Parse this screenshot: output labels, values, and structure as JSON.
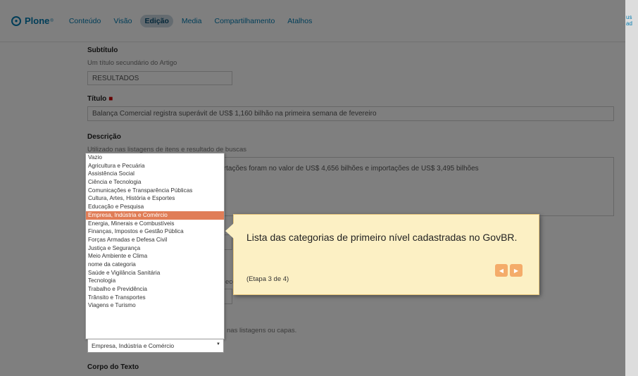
{
  "toolbar": {
    "logo": "Plone",
    "nav": [
      "Conteúdo",
      "Visão",
      "Edição",
      "Media",
      "Compartilhamento",
      "Atalhos"
    ],
    "active": "Edição",
    "user": "us ad"
  },
  "form": {
    "subtitle_label": "Subtítulo",
    "subtitle_help": "Um título secundário do Artigo",
    "subtitle_value": "RESULTADOS",
    "title_label": "Título",
    "title_value": "Balança Comercial registra superávit de US$ 1,160 bilhão na primeira semana de fevereiro",
    "description_label": "Descrição",
    "description_help": "Utilizado nas listagens de itens e resultado de buscas",
    "description_value": "Exportações foram no valor de US$ 4,656 bilhões e importações de US$ 3,495 bilhões",
    "partial_text_1": "eco",
    "partial_help_2": "nas listagens ou capas.",
    "body_label": "Corpo do Texto"
  },
  "dropdown": {
    "options": [
      "Vazio",
      "Agricultura e Pecuária",
      "Assistência Social",
      "Ciência e Tecnologia",
      "Comunicações e Transparência Públicas",
      "Cultura, Artes, História e Esportes",
      "Educação e Pesquisa",
      "Empresa, Indústria e Comércio",
      "Energia, Minerais e Combustíveis",
      "Finanças, Impostos e Gestão Pública",
      "Forças Armadas e Defesa Civil",
      "Justiça e Segurança",
      "Meio Ambiente e Clima",
      "nome da categoria",
      "Saúde e Vigilância Sanitária",
      "Tecnologia",
      "Trabalho e Previdência",
      "Trânsito e Transportes",
      "Viagens e Turismo"
    ],
    "selected_index": 7,
    "selected_value": "Empresa, Indústria e Comércio"
  },
  "tour": {
    "text": "Lista das categorias de primeiro nível cadastradas no GovBR.",
    "step": "(Etapa 3 de 4)"
  }
}
